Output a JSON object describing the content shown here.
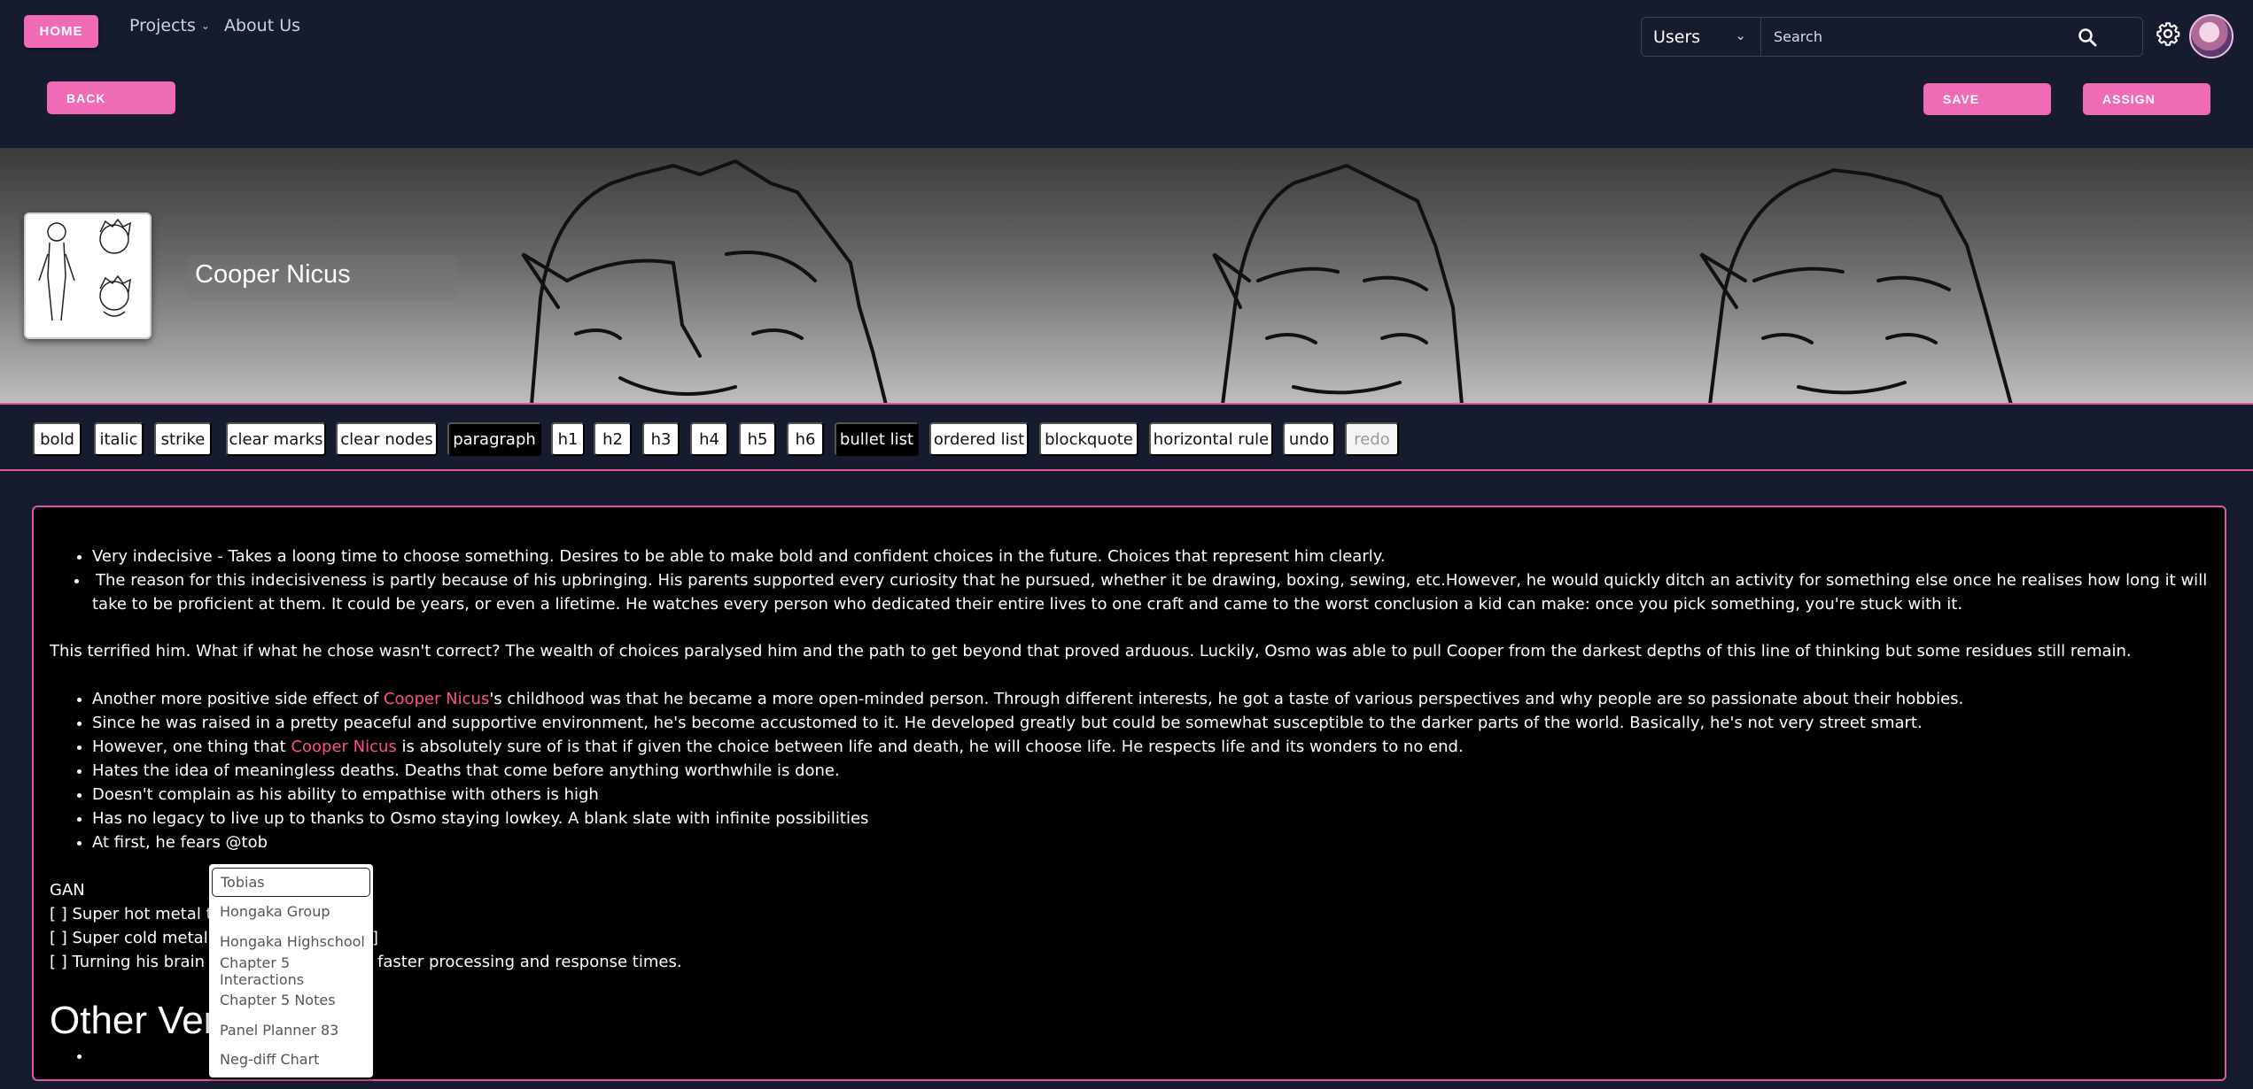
{
  "nav": {
    "home_label": "HOME",
    "projects_label": "Projects",
    "about_label": "About Us",
    "search_scope": "Users",
    "search_placeholder": "Search"
  },
  "actions": {
    "back_label": "BACK",
    "save_label": "SAVE",
    "assign_label": "ASSIGN"
  },
  "character": {
    "name": "Cooper Nicus"
  },
  "toolbar": [
    "bold",
    "italic",
    "strike",
    "clear marks",
    "clear nodes",
    "paragraph",
    "h1",
    "h2",
    "h3",
    "h4",
    "h5",
    "h6",
    "bullet list",
    "ordered list",
    "blockquote",
    "horizontal rule",
    "undo",
    "redo"
  ],
  "editor": {
    "list1": [
      "Very indecisive - Takes a loong time to choose something. Desires to be able to make bold and confident choices in the future. Choices that represent him clearly.",
      "The reason for this indecisiveness is partly because of his upbringing. His parents supported every curiosity that he pursued, whether it be drawing, boxing, sewing, etc.However, he would quickly ditch an activity for something else once he realises how long it will take to be proficient at them. It could be years, or even a lifetime. He watches every person who dedicated their entire lives to one craft and came to the worst conclusion a kid can make: once you pick something, you're stuck with it."
    ],
    "paragraph1": "This terrified him. What if what he chose wasn't correct? The wealth of choices paralysed him and the path to get beyond that proved arduous. Luckily, Osmo was able to pull Cooper from the darkest depths of this line of thinking but some residues still remain.",
    "list2": {
      "item1_pre": "Another more positive side effect of ",
      "item1_mention": "Cooper Nicus",
      "item1_post": "'s childhood was that he became a more open-minded person. Through different interests, he got a taste of various perspectives and why people are so passionate about their hobbies.",
      "item2": "Since he was raised in a pretty peaceful and supportive environment, he's become accustomed to it. He developed greatly but could be somewhat susceptible to the darker parts of the world. Basically, he's not very street smart.",
      "item3_pre": "However, one thing that ",
      "item3_mention": "Cooper Nicus",
      "item3_post": " is absolutely sure of is that if given the choice between life and death, he will choose life. He respects life and its wonders to no end.",
      "item4": "Hates the idea of meaningless deaths. Deaths that come before anything worthwhile is done.",
      "item5": "Doesn't complain as his ability to empathise with others is high",
      "item6": "Has no legacy to live up to thanks to Osmo staying lowkey. A blank slate with infinite possibilities",
      "item7": "At first, he fears @tob"
    },
    "gan_title": "GAN",
    "gan_line1": "[ ] Super hot metal thr",
    "gan_line2": "[ ] Super cold metal th",
    "gan_line2_tail": "]",
    "gan_line3": "[ ] Turning his brain int",
    "gan_line3_tail": "faster processing and response times.",
    "heading": "Other Ver"
  },
  "mention_dropdown": [
    "Tobias",
    "Hongaka Group",
    "Hongaka Highschool",
    "Chapter 5 Interactions",
    "Chapter 5 Notes",
    "Panel Planner 83",
    "Neg-diff Chart"
  ],
  "colors": {
    "accent": "#f06bb6",
    "background": "#161b2e",
    "mention": "#ff4f8b"
  }
}
